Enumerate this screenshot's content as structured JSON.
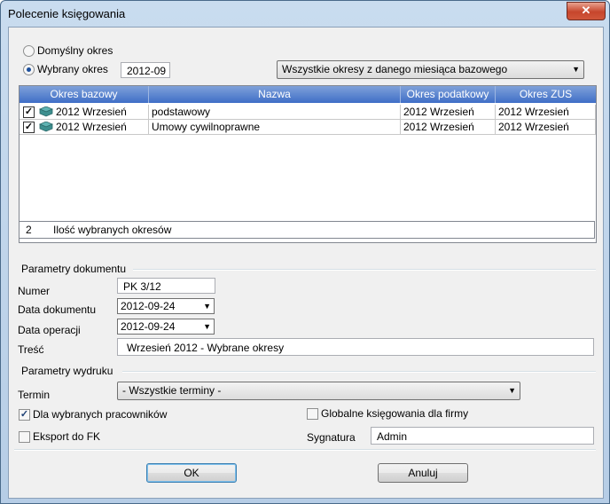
{
  "window": {
    "title": "Polecenie księgowania",
    "close_glyph": "✕"
  },
  "period": {
    "option_default": "Domyślny  okres",
    "option_selected": "Wybrany okres",
    "selected_option": "Wybrany okres",
    "period_value": "2012-09",
    "scope_value": "Wszystkie okresy z danego miesiąca bazowego"
  },
  "grid": {
    "columns": [
      "Okres bazowy",
      "Nazwa",
      "Okres podatkowy",
      "Okres ZUS"
    ],
    "rows": [
      {
        "checked": true,
        "base": "2012 Wrzesień",
        "name": "podstawowy",
        "tax": "2012 Wrzesień",
        "zus": "2012 Wrzesień"
      },
      {
        "checked": true,
        "base": "2012 Wrzesień",
        "name": "Umowy cywilnoprawne",
        "tax": "2012 Wrzesień",
        "zus": "2012 Wrzesień"
      }
    ],
    "footer_count": "2",
    "footer_label": "Ilość wybranych okresów"
  },
  "document": {
    "section_label": "Parametry dokumentu",
    "number_label": "Numer",
    "number_value": "PK 3/12",
    "doc_date_label": "Data dokumentu",
    "doc_date_value": "2012-09-24",
    "op_date_label": "Data operacji",
    "op_date_value": "2012-09-24",
    "content_label": "Treść",
    "content_value": "Wrzesień 2012 - Wybrane okresy"
  },
  "print": {
    "section_label": "Parametry wydruku",
    "term_label": "Termin",
    "term_value": "- Wszystkie terminy -",
    "selected_employees_label": "Dla wybranych pracowników",
    "selected_employees_checked": true,
    "global_postings_label": "Globalne księgowania dla firmy",
    "global_postings_checked": false,
    "export_label": "Eksport do FK",
    "export_checked": false,
    "signature_label": "Sygnatura",
    "signature_value": "Admin"
  },
  "buttons": {
    "ok": "OK",
    "cancel": "Anuluj"
  },
  "icons": {
    "dropdown": "▼",
    "check": "✓"
  }
}
